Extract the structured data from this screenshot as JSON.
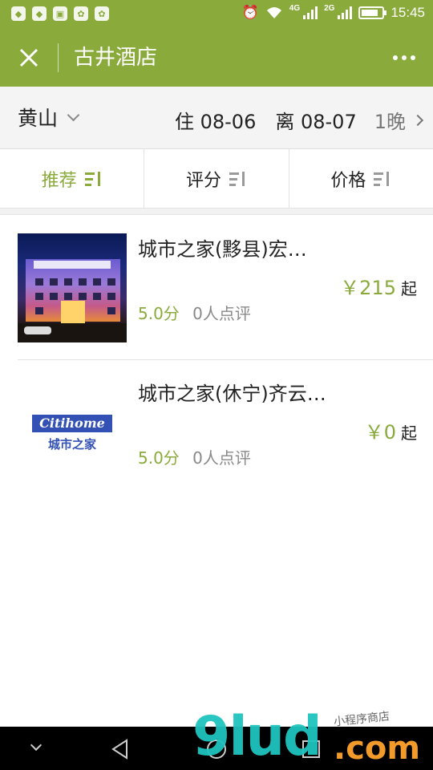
{
  "colors": {
    "accent": "#8aab3c",
    "text": "#222222",
    "muted": "#888888"
  },
  "status_bar": {
    "icons_left": [
      "shield-icon",
      "shield-icon",
      "gallery-icon",
      "paw-icon",
      "paw-icon"
    ],
    "net_4g": "4G",
    "net_2g": "2G",
    "battery_level": 0.8,
    "time": "15:45"
  },
  "header": {
    "title": "古井酒店",
    "close_icon": "close-icon",
    "more_icon": "more-icon"
  },
  "search_bar": {
    "city": "黄山",
    "checkin": "住 08-06",
    "checkout": "离 08-07",
    "nights": "1晚"
  },
  "sort_tabs": [
    {
      "label": "推荐",
      "active": true
    },
    {
      "label": "评分",
      "active": false
    },
    {
      "label": "价格",
      "active": false
    }
  ],
  "hotels": [
    {
      "name": "城市之家(黟县)宏…",
      "price": "￥215",
      "price_suffix": "起",
      "score": "5.0分",
      "reviews": "0人点评"
    },
    {
      "name": "城市之家(休宁)齐云…",
      "price": "￥0",
      "price_suffix": "起",
      "score": "5.0分",
      "reviews": "0人点评",
      "logo_text": "Citihome",
      "logo_sub": "城市之家"
    }
  ],
  "watermark": {
    "main": "9lud",
    "suffix": ".com",
    "small": "小程序商店"
  }
}
